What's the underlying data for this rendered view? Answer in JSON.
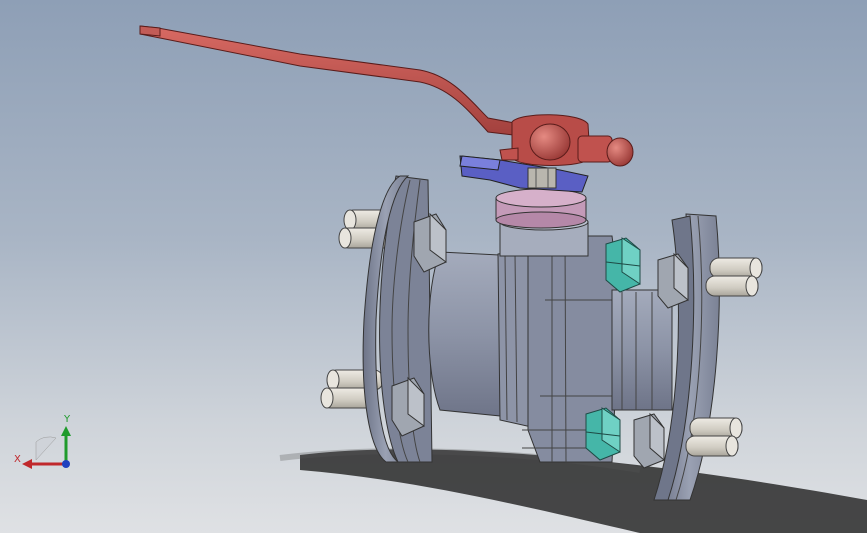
{
  "viewport": {
    "background_top": "#8e9fb6",
    "background_bottom": "#dfe1e4",
    "model": "ball-valve-assembly"
  },
  "model_colors": {
    "handle": "#c0524e",
    "gland_plate": "#5a5fc4",
    "packing_ring": "#c49ab8",
    "body": "#8c93a6",
    "bolts": "#d7d3ca",
    "nuts": "#9aa0aa",
    "cap_nuts": "#45b6a8"
  },
  "triad": {
    "x_label": "X",
    "y_label": "Y",
    "x_color": "#c0282c",
    "y_color": "#1f9b2c",
    "z_color": "#1f3fbf"
  }
}
